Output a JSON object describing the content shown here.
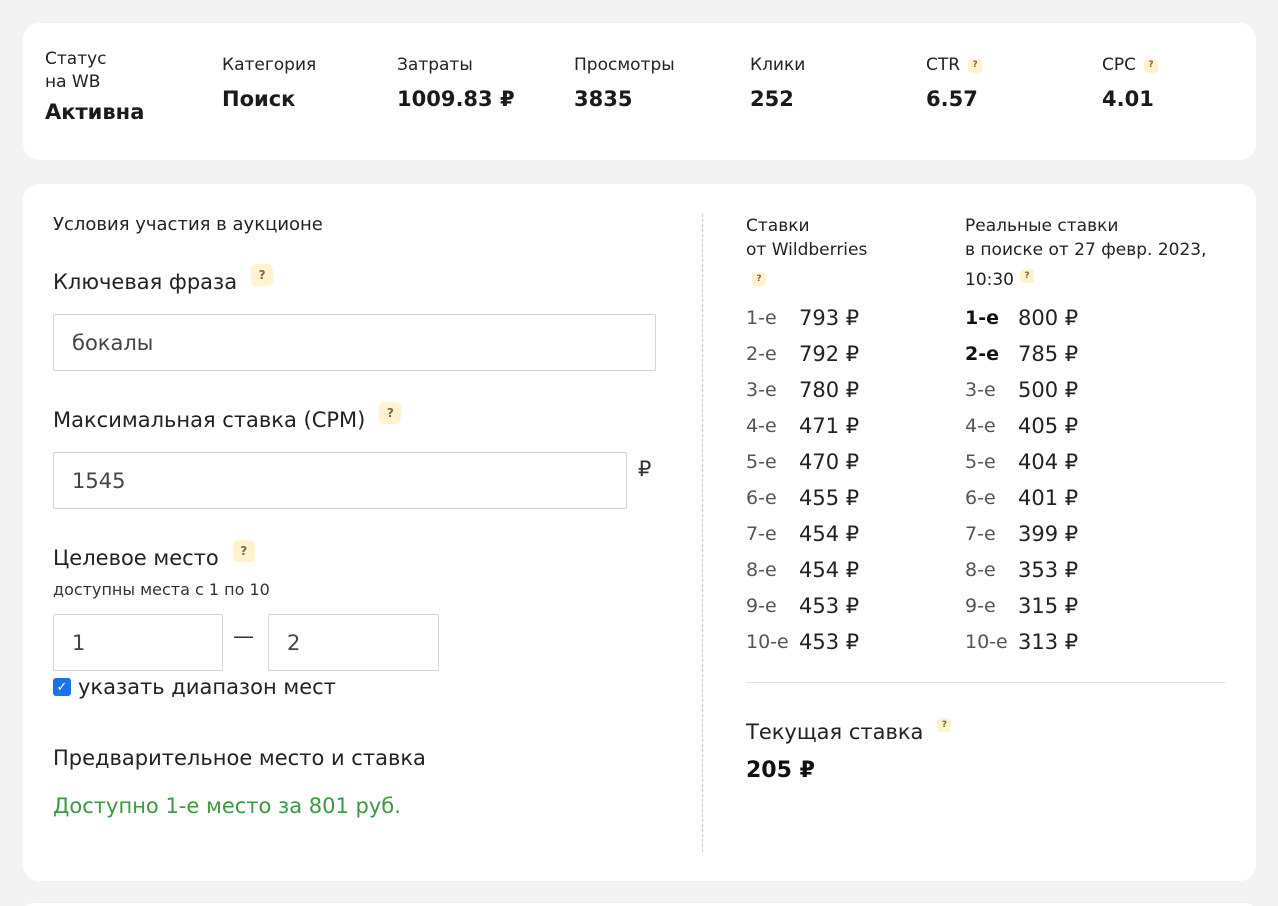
{
  "stats": {
    "status": {
      "label_line1": "Статус",
      "label_line2": "на WB",
      "value": "Активна"
    },
    "category": {
      "label": "Категория",
      "value": "Поиск"
    },
    "spend": {
      "label": "Затраты",
      "value": "1009.83 ₽"
    },
    "views": {
      "label": "Просмотры",
      "value": "3835"
    },
    "clicks": {
      "label": "Клики",
      "value": "252"
    },
    "ctr": {
      "label": "CTR",
      "value": "6.57"
    },
    "cpc": {
      "label": "CPC",
      "value": "4.01"
    }
  },
  "auction": {
    "section_title": "Условия участия в аукционе",
    "keyword_label": "Ключевая фраза",
    "keyword_value": "бокалы",
    "max_bid_label": "Максимальная ставка (CPM)",
    "max_bid_value": "1545",
    "currency": "₽",
    "target_place_label": "Целевое место",
    "target_place_hint": "доступны места с 1 по 10",
    "place_from": "1",
    "place_separator": "—",
    "place_to": "2",
    "range_checkbox_label": "указать диапазон мест",
    "range_checked": true,
    "preliminary_title": "Предварительное место и ставка",
    "preliminary_result": "Доступно 1-е место за 801 руб."
  },
  "wb_bids": {
    "header_line1": "Ставки",
    "header_line2": "от Wildberries",
    "rows": [
      {
        "rank": "1-е",
        "value": "793 ₽"
      },
      {
        "rank": "2-е",
        "value": "792 ₽"
      },
      {
        "rank": "3-е",
        "value": "780 ₽"
      },
      {
        "rank": "4-е",
        "value": "471 ₽"
      },
      {
        "rank": "5-е",
        "value": "470 ₽"
      },
      {
        "rank": "6-е",
        "value": "455 ₽"
      },
      {
        "rank": "7-е",
        "value": "454 ₽"
      },
      {
        "rank": "8-е",
        "value": "454 ₽"
      },
      {
        "rank": "9-е",
        "value": "453 ₽"
      },
      {
        "rank": "10-е",
        "value": "453 ₽"
      }
    ]
  },
  "real_bids": {
    "header_line1": "Реальные ставки",
    "header_line2": "в поиске от 27 февр. 2023,",
    "header_line3": "10:30",
    "rows": [
      {
        "rank": "1-е",
        "value": "800 ₽",
        "bold": true
      },
      {
        "rank": "2-е",
        "value": "785 ₽",
        "bold": true
      },
      {
        "rank": "3-е",
        "value": "500 ₽"
      },
      {
        "rank": "4-е",
        "value": "405 ₽"
      },
      {
        "rank": "5-е",
        "value": "404 ₽"
      },
      {
        "rank": "6-е",
        "value": "401 ₽"
      },
      {
        "rank": "7-е",
        "value": "399 ₽"
      },
      {
        "rank": "8-е",
        "value": "353 ₽"
      },
      {
        "rank": "9-е",
        "value": "315 ₽"
      },
      {
        "rank": "10-е",
        "value": "313 ₽"
      }
    ]
  },
  "current_bid": {
    "label": "Текущая ставка",
    "value": "205 ₽"
  },
  "help_glyph": "?",
  "colors": {
    "accent_green": "#3a9a3f",
    "help_bg": "#fff3cf",
    "checkbox": "#1a73e8"
  }
}
